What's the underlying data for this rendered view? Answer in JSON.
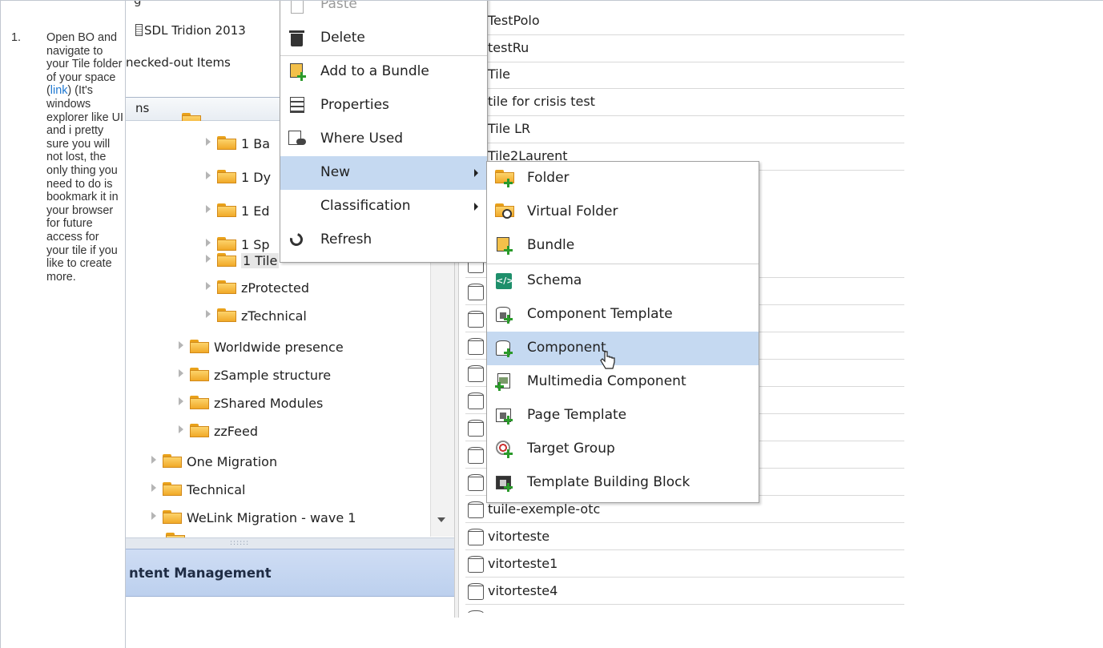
{
  "instruction": {
    "number": "1.",
    "text_before_link": "Open BO and navigate to your Tile folder of your space (",
    "link_text": "link",
    "text_after_link": ") (It's windows explorer like UI and i pretty sure you will not lost,  the only thing you need to do is bookmark it in your browser for future access for your tile if you like to create more."
  },
  "screenshot": {
    "nav": {
      "top_items": [
        "SDL Tridion 2013",
        "necked-out Items"
      ],
      "pane_header": "ns",
      "tree": [
        {
          "label": "1 Ba",
          "selected": false
        },
        {
          "label": "1 Dy",
          "selected": false
        },
        {
          "label": "1 Ed",
          "selected": false
        },
        {
          "label": "1 Sp",
          "selected": false
        },
        {
          "label": "1 Tile",
          "selected": true
        },
        {
          "label": "zProtected",
          "selected": false
        },
        {
          "label": "zTechnical",
          "selected": false
        },
        {
          "label": "Worldwide presence",
          "selected": false
        },
        {
          "label": "zSample structure",
          "selected": false
        },
        {
          "label": "zShared Modules",
          "selected": false
        },
        {
          "label": "zzFeed",
          "selected": false
        },
        {
          "label": "One Migration",
          "selected": false
        },
        {
          "label": "Technical",
          "selected": false
        },
        {
          "label": "WeLink Migration - wave 1",
          "selected": false
        }
      ],
      "splitter_grip": "::::::",
      "bottom_header": "ntent Management"
    },
    "list_items": [
      "TestPolo",
      "testRu",
      "Tile",
      "tile for crisis test",
      "Tile LR",
      "Tile2Laurent",
      "tuile-exemple-otc",
      "vitorteste",
      "vitorteste1",
      "vitorteste4"
    ],
    "context_menu": {
      "items": [
        {
          "label": "Paste",
          "icon": "paste-icon",
          "faded": true
        },
        {
          "label": "Delete",
          "icon": "trash-icon"
        },
        {
          "label": "Add to a Bundle",
          "icon": "add-bundle-icon"
        },
        {
          "label": "Properties",
          "icon": "properties-icon"
        },
        {
          "label": "Where Used",
          "icon": "where-used-icon"
        },
        {
          "label": "New",
          "icon": "",
          "submenu": true,
          "highlighted": true
        },
        {
          "label": "Classification",
          "icon": "",
          "submenu": true
        },
        {
          "label": "Refresh",
          "icon": "refresh-icon"
        }
      ]
    },
    "new_submenu": {
      "items": [
        {
          "label": "Folder",
          "icon": "new-folder-icon"
        },
        {
          "label": "Virtual Folder",
          "icon": "virtual-folder-icon"
        },
        {
          "label": "Bundle",
          "icon": "bundle-icon"
        },
        {
          "label": "Schema",
          "icon": "schema-icon"
        },
        {
          "label": "Component Template",
          "icon": "component-template-icon"
        },
        {
          "label": "Component",
          "icon": "component-icon",
          "highlighted": true
        },
        {
          "label": "Multimedia Component",
          "icon": "multimedia-component-icon"
        },
        {
          "label": "Page Template",
          "icon": "page-template-icon"
        },
        {
          "label": "Target Group",
          "icon": "target-group-icon"
        },
        {
          "label": "Template Building Block",
          "icon": "template-building-block-icon"
        }
      ]
    },
    "colors": {
      "menu_highlight": "#c5d9f1",
      "folder": "#f5b83a",
      "link": "#1f78d1",
      "section_header": "#c5d5f0"
    }
  }
}
